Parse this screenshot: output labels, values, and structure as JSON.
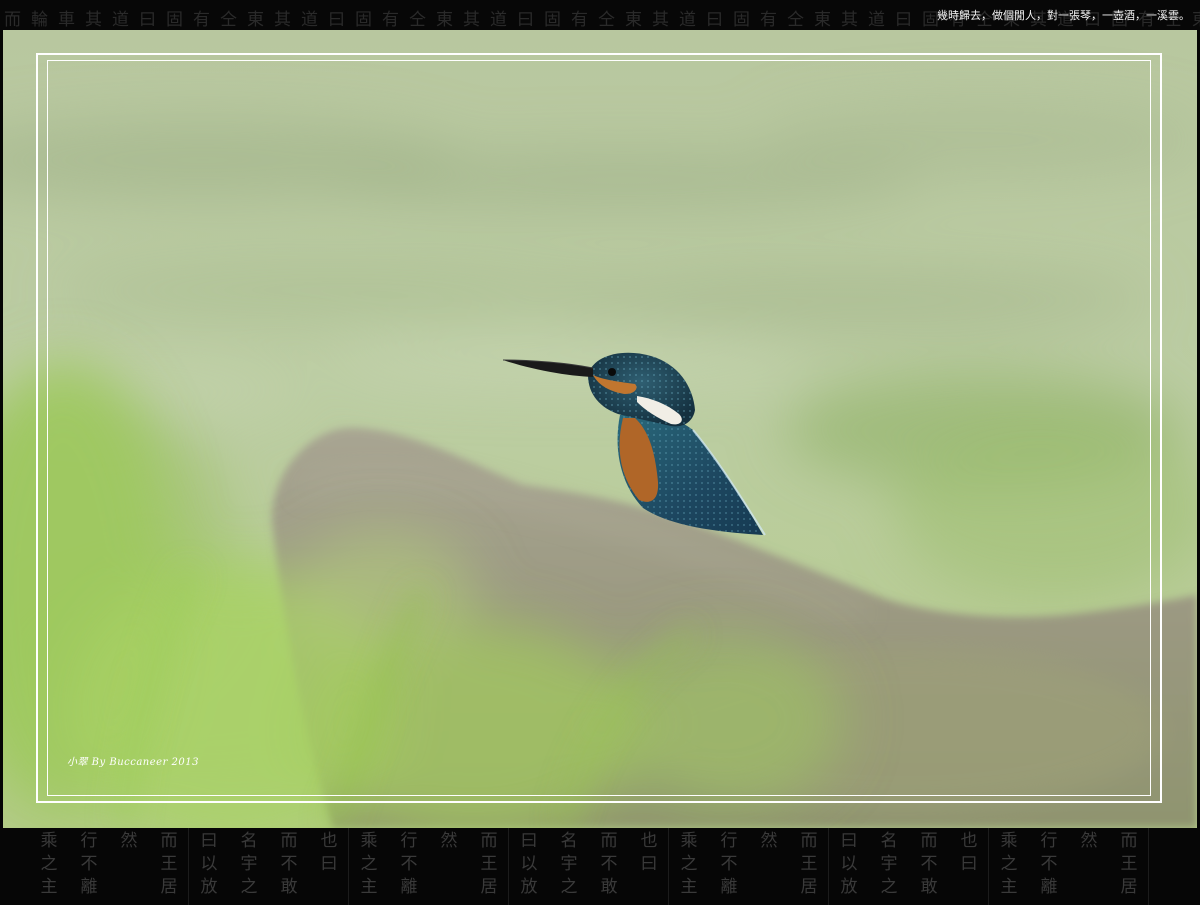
{
  "poem": "幾時歸去，做個閒人，對一張琴，一壺酒，一溪雲。",
  "signature": "小翠 By Buccaneer 2013",
  "top_pattern": "而輪車其道曰固有仝東其道曰固有仝東其道曰固有仝東其道曰固有仝東其道曰固有仝東其道曰固有仝東",
  "bottom_columns": [
    "乘之主",
    "行不離",
    "然",
    "而王居",
    "曰以放",
    "名宇之",
    "而不敢",
    "也曰",
    "乘之主",
    "行不離",
    "然",
    "而王居",
    "曰以放",
    "名宇之",
    "而不敢",
    "也曰",
    "乘之主",
    "行不離",
    "然",
    "而王居",
    "曰以放",
    "名宇之",
    "而不敢",
    "也曰",
    "乘之主",
    "行不離",
    "然",
    "而王居"
  ],
  "colors": {
    "background": "#050505",
    "frame_line": "#ffffff",
    "bokeh_green": "#b9cc9d",
    "rock": "#9e9b86",
    "kingfisher_blue": "#1f4a63",
    "kingfisher_orange": "#b46a2a"
  }
}
